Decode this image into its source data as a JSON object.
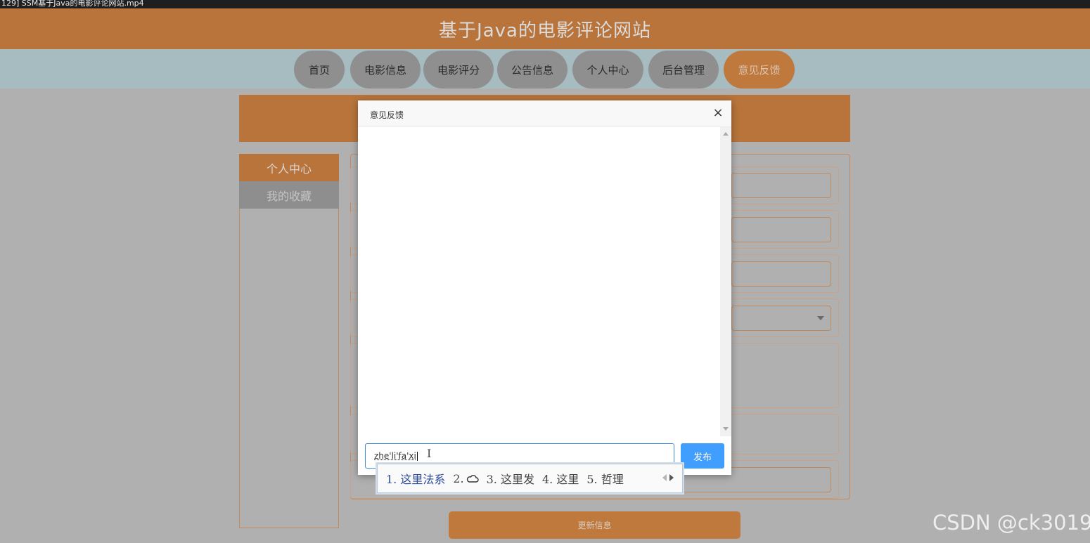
{
  "window": {
    "title": "129] SSM基于Java的电影评论网站.mp4"
  },
  "site": {
    "title": "基于Java的电影评论网站"
  },
  "nav": {
    "items": [
      {
        "label": "首页"
      },
      {
        "label": "电影信息"
      },
      {
        "label": "电影评分"
      },
      {
        "label": "公告信息"
      },
      {
        "label": "个人中心"
      },
      {
        "label": "后台管理"
      },
      {
        "label": "意见反馈",
        "active": true
      }
    ]
  },
  "sidebar": {
    "items": [
      {
        "label": "个人中心",
        "active": true
      },
      {
        "label": "我的收藏"
      }
    ]
  },
  "form": {
    "submit_label": "更新信息"
  },
  "modal": {
    "title": "意见反馈",
    "close_symbol": "×",
    "input_value": "zhe'li'fa'xi",
    "send_label": "发布"
  },
  "ime": {
    "candidates": [
      "1. 这里法系",
      "2.",
      "3. 这里发",
      "4. 这里",
      "5. 哲理"
    ]
  },
  "watermark": "CSDN @ck3019",
  "colors": {
    "brand": "#b8743b",
    "primary_button": "#409eff"
  }
}
